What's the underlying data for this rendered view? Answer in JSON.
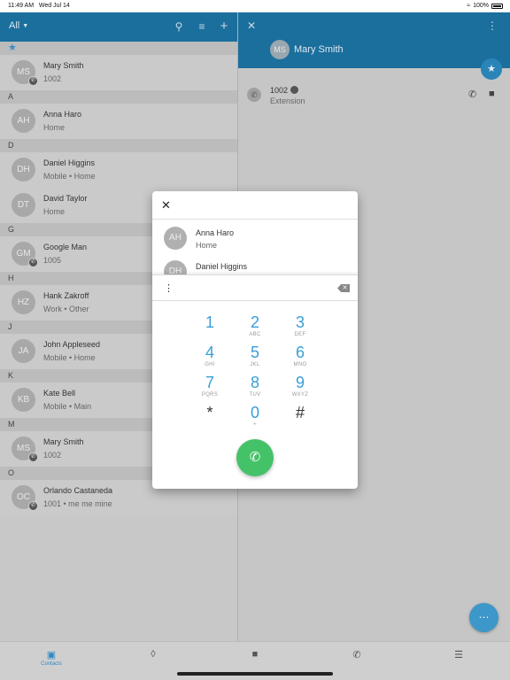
{
  "status_bar": {
    "time": "11:49 AM",
    "date": "Wed Jul 14",
    "battery": "100%"
  },
  "left_header": {
    "filter_label": "All"
  },
  "contacts": {
    "sections": [
      {
        "letter": "",
        "star": true,
        "items": [
          {
            "initials": "MS",
            "name": "Mary Smith",
            "sub": "1002",
            "badge": true
          }
        ]
      },
      {
        "letter": "A",
        "items": [
          {
            "initials": "AH",
            "name": "Anna Haro",
            "sub": "Home",
            "badge": false
          }
        ]
      },
      {
        "letter": "D",
        "items": [
          {
            "initials": "DH",
            "name": "Daniel Higgins",
            "sub": "Mobile • Home",
            "badge": false
          },
          {
            "initials": "DT",
            "name": "David Taylor",
            "sub": "Home",
            "badge": false
          }
        ]
      },
      {
        "letter": "G",
        "items": [
          {
            "initials": "GM",
            "name": "Google Man",
            "sub": "1005",
            "badge": true
          }
        ]
      },
      {
        "letter": "H",
        "items": [
          {
            "initials": "HZ",
            "name": "Hank Zakroff",
            "sub": "Work • Other",
            "badge": false
          }
        ]
      },
      {
        "letter": "J",
        "items": [
          {
            "initials": "JA",
            "name": "John Appleseed",
            "sub": "Mobile • Home",
            "badge": false
          }
        ]
      },
      {
        "letter": "K",
        "items": [
          {
            "initials": "KB",
            "name": "Kate Bell",
            "sub": "Mobile • Main",
            "badge": false
          }
        ]
      },
      {
        "letter": "M",
        "items": [
          {
            "initials": "MS",
            "name": "Mary Smith",
            "sub": "1002",
            "badge": true
          }
        ]
      },
      {
        "letter": "O",
        "items": [
          {
            "initials": "OC",
            "name": "Orlando Castaneda",
            "sub": "1001 • me me mine",
            "badge": true
          }
        ]
      }
    ]
  },
  "detail": {
    "initials": "MS",
    "name": "Mary Smith",
    "number": "1002",
    "number_label": "Extension"
  },
  "dialpad": {
    "suggestions": [
      {
        "initials": "AH",
        "name": "Anna Haro",
        "sub": "Home"
      },
      {
        "initials": "DH",
        "name": "Daniel Higgins",
        "sub": ""
      }
    ],
    "keys": [
      {
        "digit": "1",
        "letters": ""
      },
      {
        "digit": "2",
        "letters": "ABC"
      },
      {
        "digit": "3",
        "letters": "DEF"
      },
      {
        "digit": "4",
        "letters": "GHI"
      },
      {
        "digit": "5",
        "letters": "JKL"
      },
      {
        "digit": "6",
        "letters": "MNO"
      },
      {
        "digit": "7",
        "letters": "PQRS"
      },
      {
        "digit": "8",
        "letters": "TUV"
      },
      {
        "digit": "9",
        "letters": "WXYZ"
      },
      {
        "digit": "*",
        "letters": ""
      },
      {
        "digit": "0",
        "letters": "+"
      },
      {
        "digit": "#",
        "letters": ""
      }
    ]
  },
  "tabs": [
    {
      "icon": "contacts-icon",
      "label": "Contacts",
      "active": true
    },
    {
      "icon": "voicemail-icon",
      "label": "",
      "active": false
    },
    {
      "icon": "chat-icon",
      "label": "",
      "active": false
    },
    {
      "icon": "call-history-icon",
      "label": "",
      "active": false
    },
    {
      "icon": "menu-icon",
      "label": "",
      "active": false
    }
  ],
  "colors": {
    "header": "#1b6f9d",
    "accent": "#3a9fd6",
    "call": "#44c268"
  }
}
